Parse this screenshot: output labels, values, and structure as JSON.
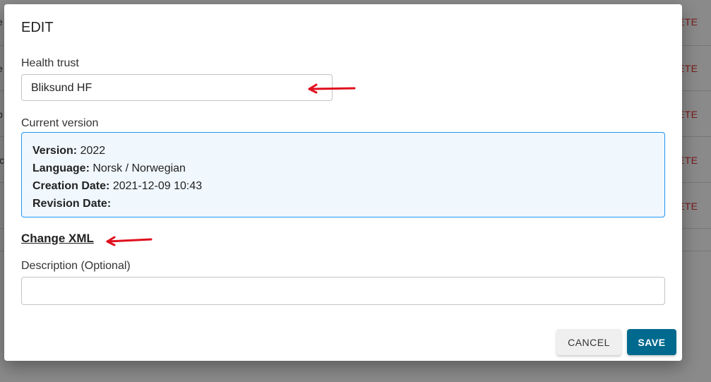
{
  "background": {
    "row_action": "DELETE",
    "row_lefts": [
      "e",
      "e",
      "p",
      "ic"
    ]
  },
  "dialog": {
    "title": "EDIT",
    "health_trust": {
      "label": "Health trust",
      "value": "Bliksund HF"
    },
    "current_version": {
      "label": "Current version",
      "version_label": "Version:",
      "version": "2022",
      "language_label": "Language:",
      "language": "Norsk / Norwegian",
      "creation_label": "Creation Date:",
      "creation": "2021-12-09 10:43",
      "revision_label": "Revision Date:",
      "revision": ""
    },
    "change_xml": "Change XML",
    "description": {
      "label": "Description (Optional)",
      "value": ""
    },
    "cancel": "CANCEL",
    "save": "SAVE"
  },
  "colors": {
    "primary": "#006a8e",
    "info_border": "#2196f3",
    "annotation": "#e0101e"
  }
}
